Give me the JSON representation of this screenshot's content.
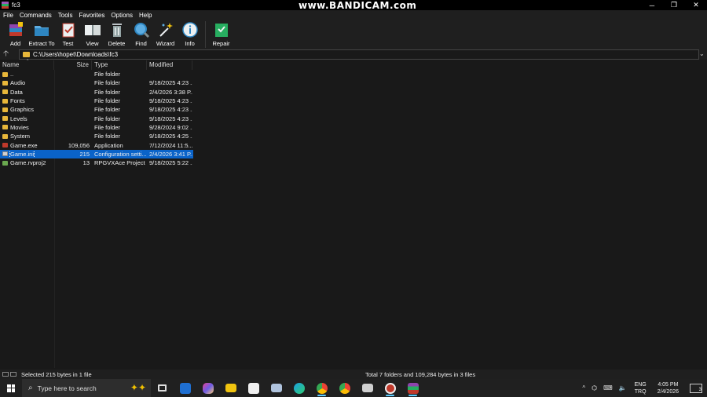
{
  "window": {
    "title": "fc3",
    "watermark": "www.BANDICAM.com",
    "controls": {
      "minimize": "─",
      "maximize": "❐",
      "close": "✕"
    }
  },
  "menu": {
    "items": [
      "File",
      "Commands",
      "Tools",
      "Favorites",
      "Options",
      "Help"
    ]
  },
  "toolbar": {
    "buttons": [
      {
        "label": "Add",
        "icon": "add-archive-icon"
      },
      {
        "label": "Extract To",
        "icon": "extract-folder-icon"
      },
      {
        "label": "Test",
        "icon": "test-clipboard-icon"
      },
      {
        "label": "View",
        "icon": "view-book-icon"
      },
      {
        "label": "Delete",
        "icon": "trash-icon"
      },
      {
        "label": "Find",
        "icon": "magnifier-icon"
      },
      {
        "label": "Wizard",
        "icon": "wand-icon"
      },
      {
        "label": "Info",
        "icon": "info-icon"
      },
      {
        "label": "Repair",
        "icon": "repair-icon"
      }
    ]
  },
  "address": {
    "up": "🡡",
    "path": "C:\\Users\\hopet\\Downloads\\fc3",
    "dropdown": "⌄"
  },
  "columns": {
    "name": "Name",
    "size": "Size",
    "type": "Type",
    "modified": "Modified",
    "sort": "^"
  },
  "files": [
    {
      "name": "..",
      "size": "",
      "type": "File folder",
      "modified": "",
      "kind": "folder"
    },
    {
      "name": "Audio",
      "size": "",
      "type": "File folder",
      "modified": "9/18/2025 4:23 ...",
      "kind": "folder"
    },
    {
      "name": "Data",
      "size": "",
      "type": "File folder",
      "modified": "2/4/2026 3:38 P...",
      "kind": "folder"
    },
    {
      "name": "Fonts",
      "size": "",
      "type": "File folder",
      "modified": "9/18/2025 4:23 ...",
      "kind": "folder"
    },
    {
      "name": "Graphics",
      "size": "",
      "type": "File folder",
      "modified": "9/18/2025 4:23 ...",
      "kind": "folder"
    },
    {
      "name": "Levels",
      "size": "",
      "type": "File folder",
      "modified": "9/18/2025 4:23 ...",
      "kind": "folder"
    },
    {
      "name": "Movies",
      "size": "",
      "type": "File folder",
      "modified": "9/28/2024 9:02 ...",
      "kind": "folder"
    },
    {
      "name": "System",
      "size": "",
      "type": "File folder",
      "modified": "9/18/2025 4:25 ...",
      "kind": "folder"
    },
    {
      "name": "Game.exe",
      "size": "109,056",
      "type": "Application",
      "modified": "7/12/2024 11:5...",
      "kind": "exe"
    },
    {
      "name": "Game.ini",
      "size": "215",
      "type": "Configuration setti...",
      "modified": "2/4/2026 3:41 P...",
      "kind": "ini",
      "selected": true
    },
    {
      "name": "Game.rvproj2",
      "size": "13",
      "type": "RPGVXAce Project",
      "modified": "9/18/2025 5:22 ...",
      "kind": "proj"
    }
  ],
  "status": {
    "left": "Selected 215 bytes in 1 file",
    "right": "Total 7 folders and 109,284 bytes in 3 files"
  },
  "taskbar": {
    "search_placeholder": "Type here to search",
    "apps": [
      "task-view-icon",
      "mail-icon",
      "copilot-icon",
      "file-explorer-icon",
      "store-icon",
      "monitor-app-icon",
      "edge-icon",
      "chrome-icon",
      "chrome-icon",
      "winrar-file-icon",
      "bandicam-record-icon",
      "winrar-icon"
    ],
    "tray": {
      "chevron": "^",
      "lang_top": "ENG",
      "lang_bottom": "TRQ",
      "time": "4:05 PM",
      "date": "2/4/2026",
      "notif_count": "3"
    }
  }
}
